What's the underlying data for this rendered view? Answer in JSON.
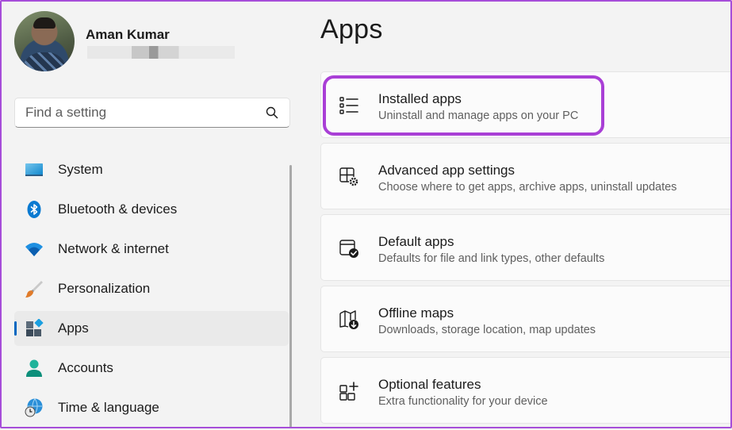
{
  "profile": {
    "name": "Aman Kumar",
    "email_redacted": ""
  },
  "search": {
    "placeholder": "Find a setting",
    "value": ""
  },
  "sidebar": {
    "items": [
      {
        "label": "System",
        "icon": "monitor-icon",
        "active": false
      },
      {
        "label": "Bluetooth & devices",
        "icon": "bluetooth-icon",
        "active": false
      },
      {
        "label": "Network & internet",
        "icon": "wifi-icon",
        "active": false
      },
      {
        "label": "Personalization",
        "icon": "paintbrush-icon",
        "active": false
      },
      {
        "label": "Apps",
        "icon": "apps-icon",
        "active": true
      },
      {
        "label": "Accounts",
        "icon": "person-icon",
        "active": false
      },
      {
        "label": "Time & language",
        "icon": "globe-clock-icon",
        "active": false
      }
    ]
  },
  "main": {
    "title": "Apps",
    "cards": [
      {
        "title": "Installed apps",
        "subtitle": "Uninstall and manage apps on your PC",
        "icon": "list-icon",
        "highlighted": true
      },
      {
        "title": "Advanced app settings",
        "subtitle": "Choose where to get apps, archive apps, uninstall updates",
        "icon": "app-settings-icon",
        "highlighted": false
      },
      {
        "title": "Default apps",
        "subtitle": "Defaults for file and link types, other defaults",
        "icon": "default-apps-icon",
        "highlighted": false
      },
      {
        "title": "Offline maps",
        "subtitle": "Downloads, storage location, map updates",
        "icon": "map-download-icon",
        "highlighted": false
      },
      {
        "title": "Optional features",
        "subtitle": "Extra functionality for your device",
        "icon": "add-feature-icon",
        "highlighted": false
      }
    ]
  },
  "colors": {
    "accent": "#0067c0",
    "highlight_border": "#a93fd6",
    "background": "#f3f3f3",
    "card": "#fbfbfb"
  }
}
